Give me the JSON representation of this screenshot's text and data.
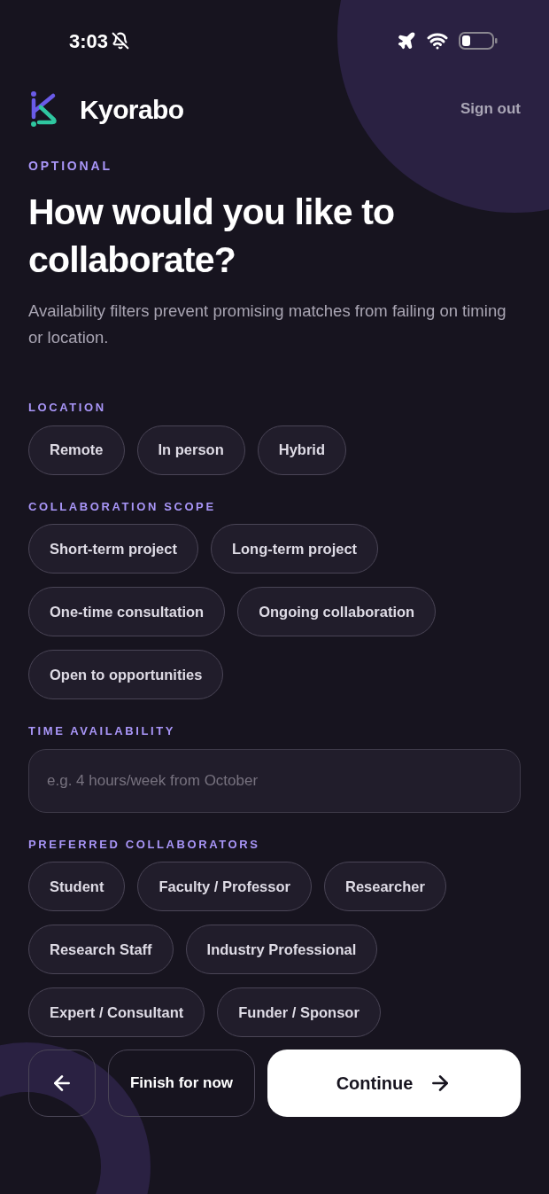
{
  "status_bar": {
    "time": "3:03"
  },
  "header": {
    "brand": "Kyorabo",
    "sign_out": "Sign out"
  },
  "eyebrow": "OPTIONAL",
  "title": "How would you like to collaborate?",
  "subtitle": "Availability filters prevent promising matches from failing on timing or location.",
  "sections": [
    {
      "kind": "chips",
      "label": "LOCATION",
      "options": [
        {
          "label": "Remote",
          "selected": false
        },
        {
          "label": "In person",
          "selected": false
        },
        {
          "label": "Hybrid",
          "selected": false
        }
      ]
    },
    {
      "kind": "chips",
      "label": "COLLABORATION SCOPE",
      "options": [
        {
          "label": "Short-term project",
          "selected": false
        },
        {
          "label": "Long-term project",
          "selected": false
        },
        {
          "label": "One-time consultation",
          "selected": false
        },
        {
          "label": "Ongoing collaboration",
          "selected": false
        },
        {
          "label": "Open to opportunities",
          "selected": false
        }
      ]
    },
    {
      "kind": "field",
      "label": "TIME AVAILABILITY",
      "placeholder": "e.g. 4 hours/week from October"
    },
    {
      "kind": "chips",
      "label": "PREFERRED COLLABORATORS",
      "options": [
        {
          "label": "Student",
          "selected": false
        },
        {
          "label": "Faculty / Professor",
          "selected": false
        },
        {
          "label": "Researcher",
          "selected": false
        },
        {
          "label": "Research Staff",
          "selected": false
        },
        {
          "label": "Industry Professional",
          "selected": false
        },
        {
          "label": "Expert / Consultant",
          "selected": false
        },
        {
          "label": "Funder / Sponsor",
          "selected": false
        }
      ]
    }
  ],
  "footer": {
    "secondary": "Finish for now",
    "primary": "Continue"
  }
}
